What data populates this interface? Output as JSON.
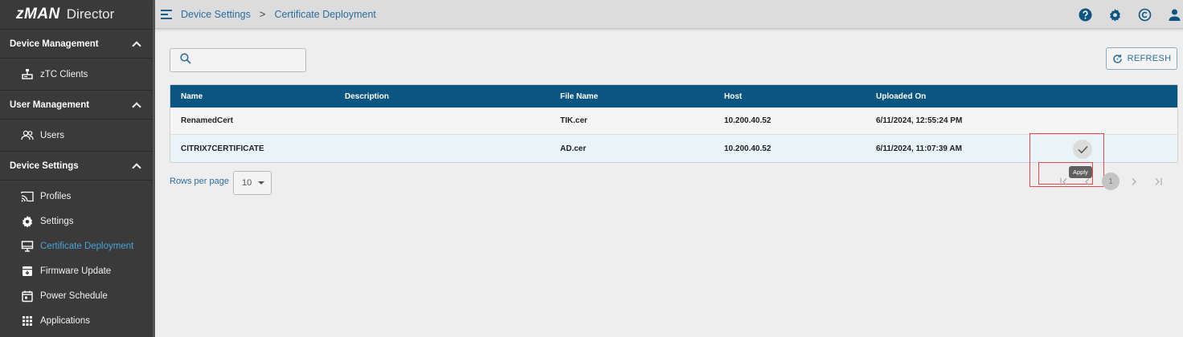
{
  "app": {
    "logo_mark": "zMAN",
    "logo_text": "Director"
  },
  "sidebar": {
    "sections": [
      {
        "title": "Device Management",
        "items": [
          {
            "label": "zTC Clients",
            "icon": "terminal-icon"
          }
        ]
      },
      {
        "title": "User Management",
        "items": [
          {
            "label": "Users",
            "icon": "users-icon"
          }
        ]
      },
      {
        "title": "Device Settings",
        "items": [
          {
            "label": "Profiles",
            "icon": "cast-icon"
          },
          {
            "label": "Settings",
            "icon": "gear-icon"
          },
          {
            "label": "Certificate Deployment",
            "icon": "monitor-icon",
            "active": true
          },
          {
            "label": "Firmware Update",
            "icon": "archive-icon"
          },
          {
            "label": "Power Schedule",
            "icon": "calendar-icon"
          },
          {
            "label": "Applications",
            "icon": "grid-icon"
          }
        ]
      }
    ]
  },
  "breadcrumb": {
    "parent": "Device Settings",
    "separator": ">",
    "current": "Certificate Deployment"
  },
  "search": {
    "placeholder": "",
    "value": ""
  },
  "refresh": {
    "label": "REFRESH"
  },
  "table": {
    "columns": [
      "Name",
      "Description",
      "File Name",
      "Host",
      "Uploaded On"
    ],
    "rows": [
      {
        "name": "RenamedCert",
        "description": "",
        "file": "TIK.cer",
        "host": "10.200.40.52",
        "uploaded": "6/11/2024, 12:55:24 PM"
      },
      {
        "name": "CITRIX7CERTIFICATE",
        "description": "",
        "file": "AD.cer",
        "host": "10.200.40.52",
        "uploaded": "6/11/2024, 11:07:39 AM"
      }
    ]
  },
  "tooltip": {
    "apply": "Apply"
  },
  "pagination": {
    "rows_label": "Rows per page",
    "rows_value": "10",
    "current_page": "1"
  },
  "colors": {
    "accent": "#2c6e9e",
    "header": "#0b5583",
    "sidebar": "#3a3a3a",
    "highlight": "#e54b4b"
  }
}
